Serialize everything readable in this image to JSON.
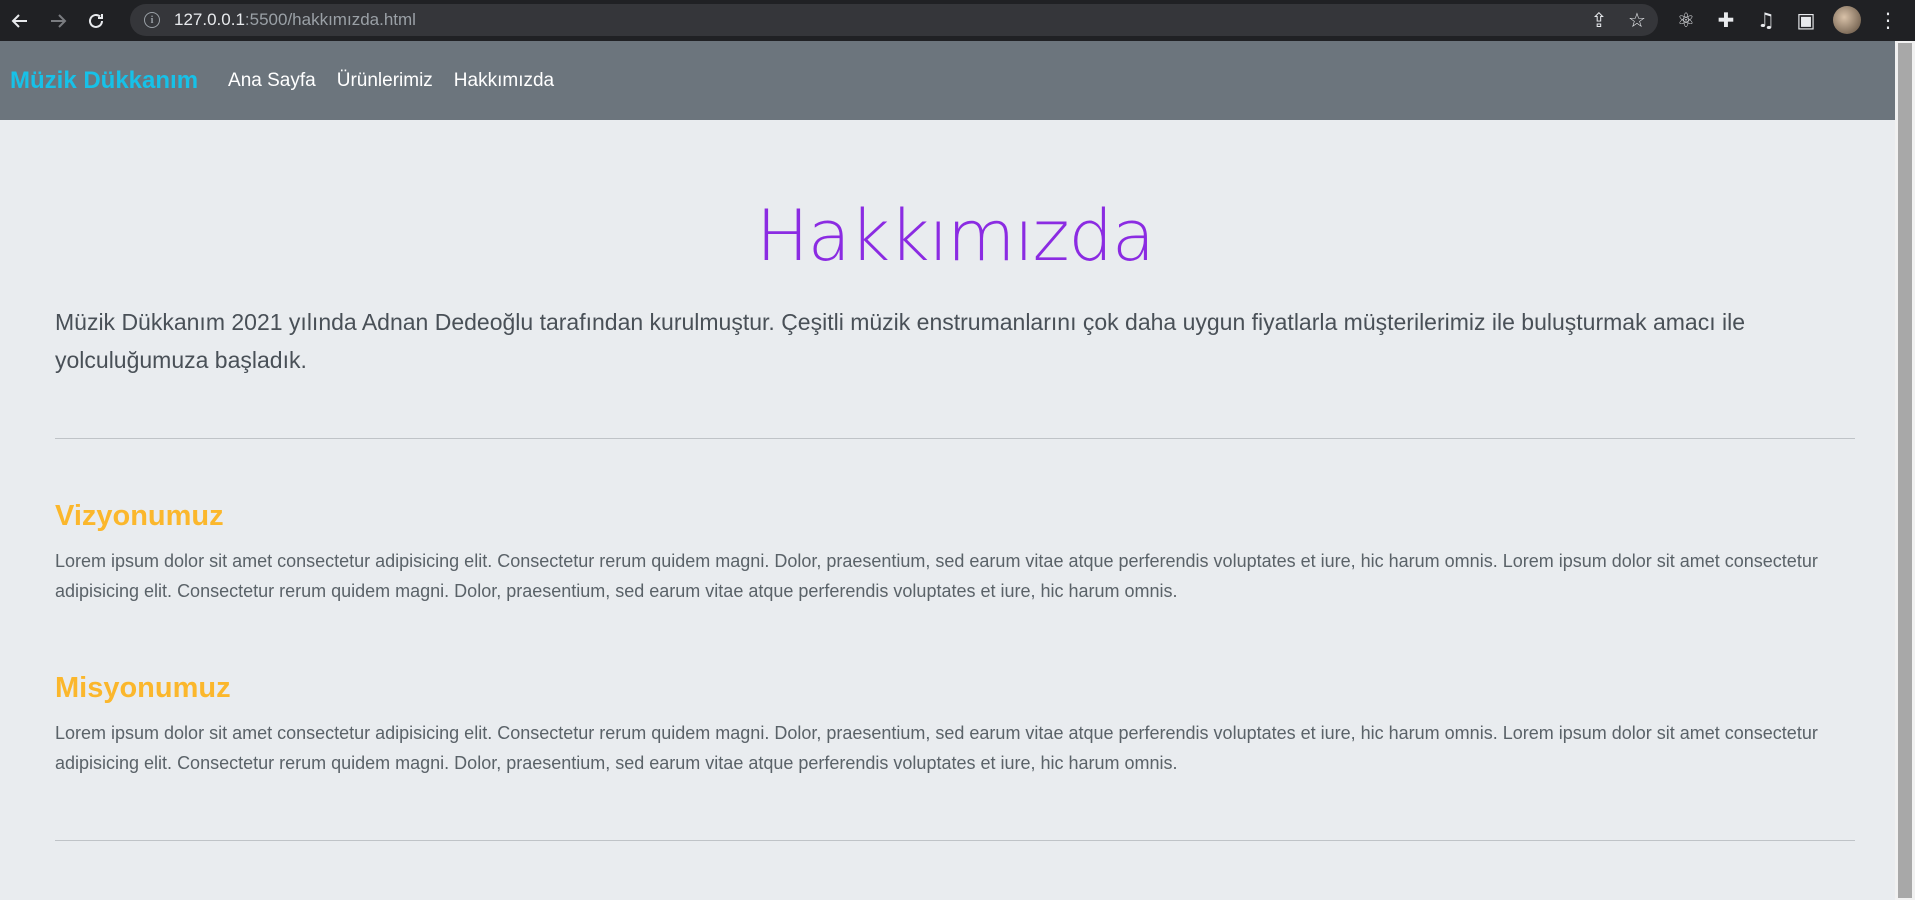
{
  "browser": {
    "url_host": "127.0.0.1",
    "url_rest": ":5500/hakkımızda.html"
  },
  "site": {
    "brand": "Müzik Dükkanım",
    "nav": [
      "Ana Sayfa",
      "Ürünlerimiz",
      "Hakkımızda"
    ]
  },
  "page": {
    "title": "Hakkımızda",
    "intro": "Müzik Dükkanım 2021 yılında Adnan Dedeoğlu tarafından kurulmuştur. Çeşitli müzik enstrumanlarını çok daha uygun fiyatlarla müşterilerimiz ile buluşturmak amacı ile yolculuğumuza başladık.",
    "sections": [
      {
        "heading": "Vizyonumuz",
        "text": "Lorem ipsum dolor sit amet consectetur adipisicing elit. Consectetur rerum quidem magni. Dolor, praesentium, sed earum vitae atque perferendis voluptates et iure, hic harum omnis. Lorem ipsum dolor sit amet consectetur adipisicing elit. Consectetur rerum quidem magni. Dolor, praesentium, sed earum vitae atque perferendis voluptates et iure, hic harum omnis."
      },
      {
        "heading": "Misyonumuz",
        "text": "Lorem ipsum dolor sit amet consectetur adipisicing elit. Consectetur rerum quidem magni. Dolor, praesentium, sed earum vitae atque perferendis voluptates et iure, hic harum omnis. Lorem ipsum dolor sit amet consectetur adipisicing elit. Consectetur rerum quidem magni. Dolor, praesentium, sed earum vitae atque perferendis voluptates et iure, hic harum omnis."
      }
    ]
  },
  "colors": {
    "navbar_bg": "#6c757d",
    "brand": "#17c1e8",
    "title": "#8b2be2",
    "section_heading": "#fbb72c",
    "page_bg": "#e9ecef"
  },
  "icons": {
    "back": "arrow-left-icon",
    "forward": "arrow-right-icon",
    "reload": "reload-icon",
    "site_info": "info-icon",
    "share": "share-icon",
    "bookmark": "star-icon",
    "extension_react": "react-icon",
    "extensions": "puzzle-icon",
    "media": "media-queue-icon",
    "side_panel": "side-panel-icon",
    "menu": "kebab-menu-icon"
  }
}
